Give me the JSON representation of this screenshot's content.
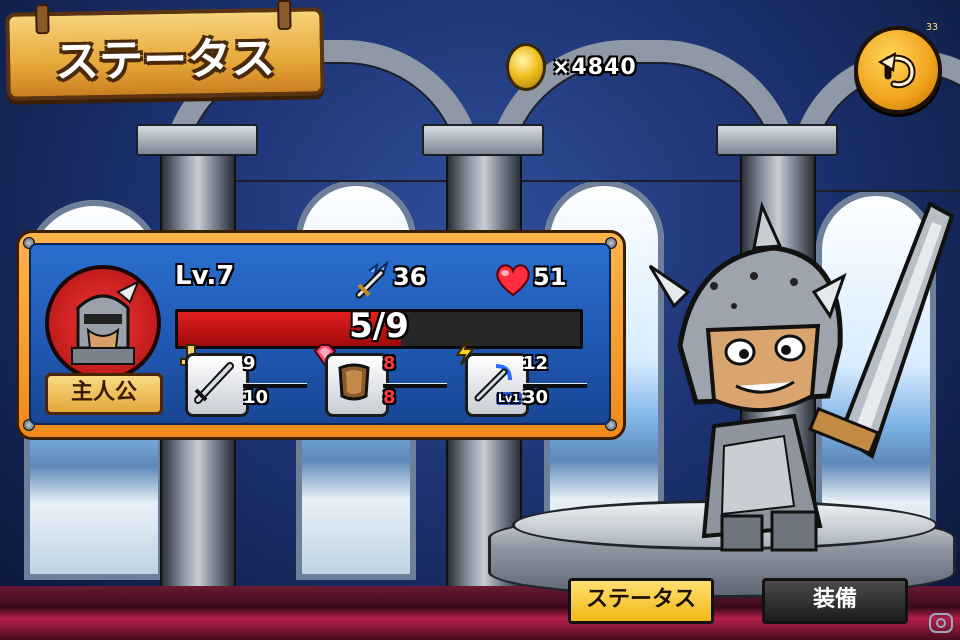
{
  "screen": {
    "title": "ステータス",
    "coins": "×4840",
    "corner_number": "33"
  },
  "character": {
    "name": "主人公",
    "level": "Lv.7",
    "attack": "36",
    "heart": "51",
    "hp_text": "5/9",
    "hp_current": 5,
    "hp_max": 9
  },
  "equipment": [
    {
      "icon": "sword-icon",
      "badge": "hilt-badge-icon",
      "top": "9",
      "bottom": "10",
      "top_color": "#ffffff",
      "bottom_color": "#ffffff"
    },
    {
      "icon": "bracer-icon",
      "badge": "gem-badge-icon",
      "top": "8",
      "bottom": "8",
      "top_color": "#ff3a3a",
      "bottom_color": "#ff3a3a"
    },
    {
      "icon": "magic-sword-icon",
      "badge": "lightning-badge-icon",
      "level_tag": "Lv1",
      "top": "12",
      "bottom": "30",
      "top_color": "#ffffff",
      "bottom_color": "#ffffff"
    }
  ],
  "buttons": {
    "status": "ステータス",
    "equip": "装備"
  },
  "colors": {
    "panel_border": "#f08a1a",
    "panel_fill": "#1f57b0",
    "hp_fill": "#e02020",
    "active_tab": "#f2b818"
  }
}
